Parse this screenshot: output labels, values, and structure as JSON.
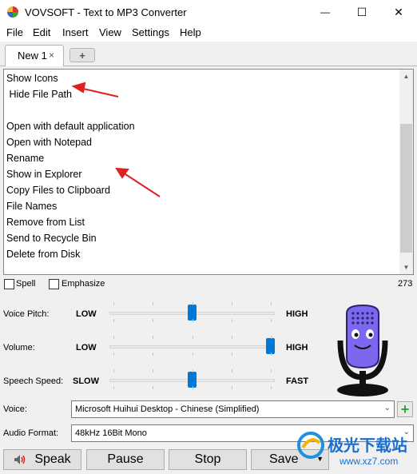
{
  "window": {
    "title": "VOVSOFT - Text to MP3 Converter",
    "minimize_glyph": "—",
    "maximize_glyph": "☐",
    "close_glyph": "✕"
  },
  "menu": [
    "File",
    "Edit",
    "Insert",
    "View",
    "Settings",
    "Help"
  ],
  "tabs": {
    "active_label": "New 1",
    "close_glyph": "×",
    "add_glyph": "+"
  },
  "editor": {
    "lines": [
      "Show Icons",
      " Hide File Path",
      "",
      "Open with default application",
      "Open with Notepad",
      "Rename",
      "Show in Explorer",
      "Copy Files to Clipboard",
      "File Names",
      "Remove from List",
      "Send to Recycle Bin",
      "Delete from Disk"
    ]
  },
  "options": {
    "spell_label": "Spell",
    "spell_checked": false,
    "emphasize_label": "Emphasize",
    "emphasize_checked": false,
    "char_count": "273"
  },
  "sliders": {
    "pitch": {
      "label": "Voice Pitch:",
      "min_label": "LOW",
      "max_label": "HIGH",
      "value": 0.5
    },
    "volume": {
      "label": "Volume:",
      "min_label": "LOW",
      "max_label": "HIGH",
      "value": 1.0
    },
    "speed": {
      "label": "Speech Speed:",
      "min_label": "SLOW",
      "max_label": "FAST",
      "value": 0.5
    }
  },
  "voice": {
    "label": "Voice:",
    "selected": "Microsoft Huihui Desktop - Chinese (Simplified)",
    "add_glyph": "+"
  },
  "audio_format": {
    "label": "Audio Format:",
    "selected": "48kHz 16Bit Mono"
  },
  "buttons": {
    "speak": "Speak",
    "pause": "Pause",
    "stop": "Stop",
    "save": "Save"
  },
  "watermark": {
    "brand": "极光下载站",
    "url": "www.xz7.com"
  },
  "colors": {
    "accent_blue": "#0078d7",
    "annotation_red": "#e02020",
    "mic_body": "#7b68ee",
    "add_green": "#33a532"
  }
}
